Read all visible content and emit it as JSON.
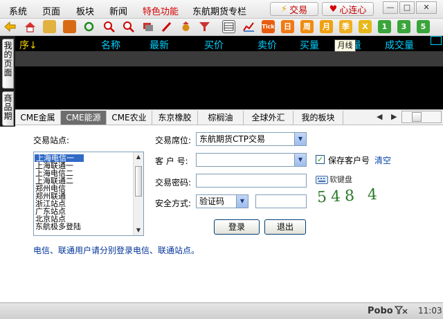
{
  "menu": {
    "items": [
      "系统",
      "页面",
      "板块",
      "新闻"
    ],
    "special": "特色功能",
    "column": "东航期货专栏",
    "trade_label": "交易",
    "lian_label": "心连心"
  },
  "window": {
    "min_glyph": "—",
    "max_glyph": "□",
    "close_glyph": "✕"
  },
  "toolbar": {
    "tick_label": "Tick",
    "day_label": "日",
    "week_label": "周",
    "month_label": "月",
    "season_label": "季",
    "x_label": "X",
    "num1": "1",
    "num3": "3",
    "num5": "5"
  },
  "left_tabs": {
    "my_page": "我的页面",
    "goods_period": "商品期"
  },
  "quote_table": {
    "sort_label": "序↓",
    "columns": [
      "名称",
      "最新",
      "买价",
      "卖价",
      "买量",
      "卖量",
      "成交量"
    ],
    "tooltip": "月线"
  },
  "board_tabs": {
    "items": [
      "CME金属",
      "CME能源",
      "CME农业",
      "东京橡胶",
      "棕榈油",
      "全球外汇",
      "我的板块"
    ],
    "active_index": 1,
    "prev": "◀",
    "next": "▶"
  },
  "login": {
    "site_label": "交易站点:",
    "sites": [
      "上海电信一",
      "上海联通一",
      "上海电信二",
      "上海联通二",
      "郑州电信",
      "郑州联通",
      "浙江站点",
      "广东站点",
      "北京站点",
      "东航极多登陆"
    ],
    "selected_site": 0,
    "seat_label": "交易席位:",
    "seat_value": "东航期货CTP交易",
    "account_label": "客 户 号:",
    "account_value": "",
    "save_account_label": "保存客户号",
    "save_checked": true,
    "clear_label": "清空",
    "password_label": "交易密码:",
    "soft_keyboard_label": "软键盘",
    "security_label": "安全方式:",
    "security_value": "验证码",
    "captcha": "548 4",
    "login_button": "登录",
    "exit_button": "退出",
    "notice": "电信、联通用户请分别登录电信、联通站点。"
  },
  "status": {
    "brand": "Pobo",
    "time": "11:03"
  }
}
